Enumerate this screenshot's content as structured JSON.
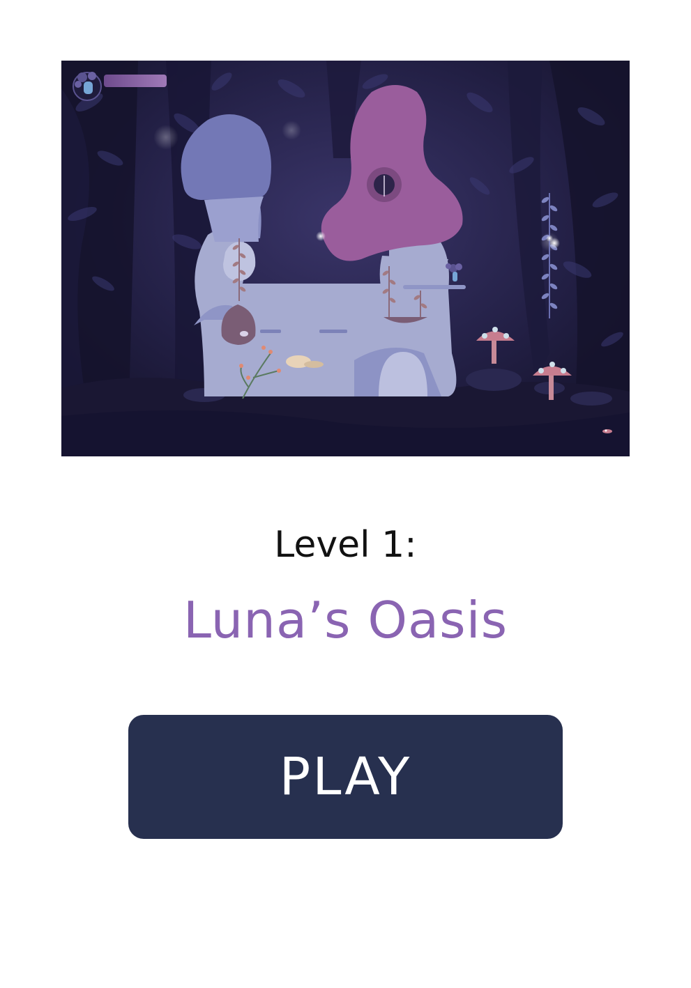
{
  "level": {
    "label": "Level 1:",
    "name": "Luna’s Oasis"
  },
  "play_button": {
    "label": "PLAY"
  },
  "colors": {
    "level_name": "#8a64b2",
    "play_button_bg": "#27304f",
    "play_button_text": "#ffffff",
    "forest_bg": "#1f1c3d",
    "mushroom_blue": "#7378b6",
    "mushroom_purple": "#9a5d9c",
    "house_lavender": "#a6abd0",
    "health_bar": "#8e6aa7"
  },
  "game_preview": {
    "icons": [
      "player-portrait-icon",
      "health-bar",
      "firefly-icon",
      "red-spotted-mushroom-icon"
    ]
  }
}
